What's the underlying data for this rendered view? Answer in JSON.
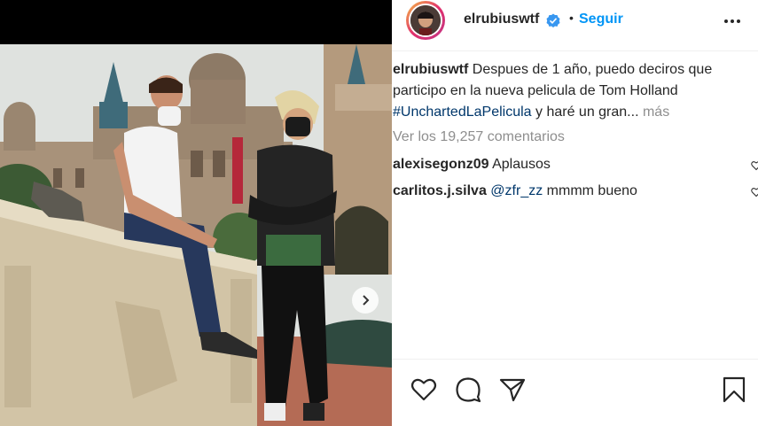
{
  "post": {
    "username": "elrubiuswtf",
    "verified_icon": "verified-badge-icon",
    "separator": "•",
    "follow_label": "Seguir",
    "more_icon": "more-options-icon"
  },
  "caption": {
    "username": "elrubiuswtf",
    "text_before": "Despues de 1 año, puedo deciros que participo en la nueva pelicula de Tom Holland",
    "hashtag": "#UnchartedLaPelicula",
    "text_after": "y haré un gran...",
    "more_label": "más"
  },
  "view_comments_label": "Ver los 19,257 comentarios",
  "comments": [
    {
      "username": "alexisegonz09",
      "mention": "",
      "text": "Aplausos"
    },
    {
      "username": "carlitos.j.silva",
      "mention": "@zfr_zz",
      "text": "mmmm bueno"
    }
  ],
  "actions": {
    "like_icon": "heart-icon",
    "comment_icon": "comment-icon",
    "share_icon": "share-icon",
    "save_icon": "bookmark-icon"
  },
  "photo": {
    "next_icon": "chevron-right-icon"
  },
  "colors": {
    "link_blue": "#0095f6",
    "hashtag_blue": "#00376b",
    "muted": "#8e8e8e",
    "text": "#262626"
  }
}
